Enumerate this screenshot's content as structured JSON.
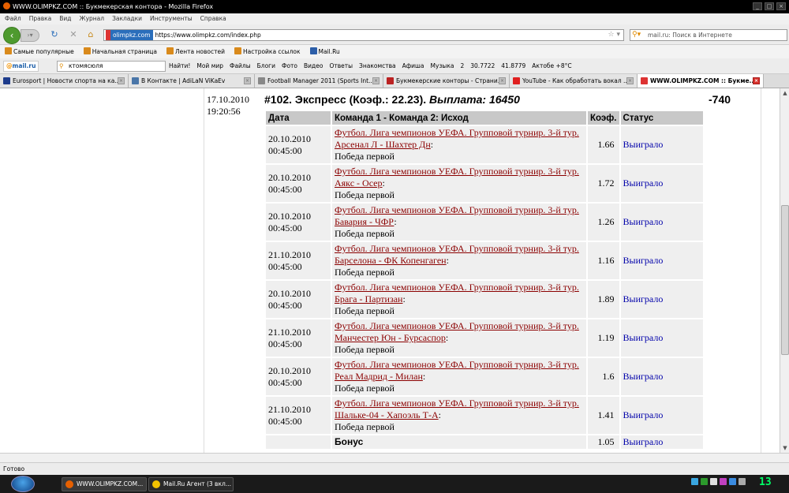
{
  "window": {
    "title": "WWW.OLIMPKZ.COM :: Букмекерская контора - Mozilla Firefox"
  },
  "menu": [
    "Файл",
    "Правка",
    "Вид",
    "Журнал",
    "Закладки",
    "Инструменты",
    "Справка"
  ],
  "nav": {
    "site_label": "olimpkz.com",
    "url": "https://www.olimpkz.com/index.php",
    "search_placeholder": "mail.ru: Поиск в Интернете"
  },
  "bookmarks": [
    "Самые популярные",
    "Начальная страница",
    "Лента новостей",
    "Настройка ссылок",
    "Mail.Ru"
  ],
  "mailru": {
    "logo": "mail.ru",
    "search_value": "ктомясюля",
    "find_label": "Найти!",
    "items": [
      "Мой мир",
      "Файлы",
      "Блоги",
      "Фото",
      "Видео",
      "Ответы",
      "Знакомства",
      "Афиша",
      "Музыка",
      "2",
      "30.7722",
      "41.8779",
      "Актобе +8°C"
    ]
  },
  "tabs": [
    "Eurosport | Новости спорта на ка...",
    "В Контакте | AdiLaN ViKaEv",
    "Football Manager 2011 (Sports Int...",
    "Букмекерские конторы - Страни...",
    "YouTube - Как обработать вокал ...",
    "WWW.OLIMPKZ.COM :: Букме..."
  ],
  "bet": {
    "date": "17.10.2010",
    "time": "19:20:56",
    "title": "#102. Экспресс (Коэф.: 22.23).",
    "payout": "Выплата: 16450",
    "result": "-740",
    "headers": {
      "date": "Дата",
      "match": "Команда 1 - Команда 2: Исход",
      "coef": "Коэф.",
      "status": "Статус"
    },
    "rows": [
      {
        "date": "20.10.2010",
        "time": "00:45:00",
        "event": "Футбол. Лига чемпионов УЕФА. Групповой турнир. 3-й тур. Арсенал Л - Шахтер Дн",
        "outcome": "Победа первой",
        "coef": "1.66",
        "status": "Выиграло"
      },
      {
        "date": "20.10.2010",
        "time": "00:45:00",
        "event": "Футбол. Лига чемпионов УЕФА. Групповой турнир. 3-й тур. Аякс - Осер",
        "outcome": "Победа первой",
        "coef": "1.72",
        "status": "Выиграло"
      },
      {
        "date": "20.10.2010",
        "time": "00:45:00",
        "event": "Футбол. Лига чемпионов УЕФА. Групповой турнир. 3-й тур. Бавария - ЧФР",
        "outcome": "Победа первой",
        "coef": "1.26",
        "status": "Выиграло"
      },
      {
        "date": "21.10.2010",
        "time": "00:45:00",
        "event": "Футбол. Лига чемпионов УЕФА. Групповой турнир. 3-й тур. Барселона - ФК Копенгаген",
        "outcome": "Победа первой",
        "coef": "1.16",
        "status": "Выиграло"
      },
      {
        "date": "20.10.2010",
        "time": "00:45:00",
        "event": "Футбол. Лига чемпионов УЕФА. Групповой турнир. 3-й тур. Брага - Партизан",
        "outcome": "Победа первой",
        "coef": "1.89",
        "status": "Выиграло"
      },
      {
        "date": "21.10.2010",
        "time": "00:45:00",
        "event": "Футбол. Лига чемпионов УЕФА. Групповой турнир. 3-й тур. Манчестер Юн - Бурсаспор",
        "outcome": "Победа первой",
        "coef": "1.19",
        "status": "Выиграло"
      },
      {
        "date": "20.10.2010",
        "time": "00:45:00",
        "event": "Футбол. Лига чемпионов УЕФА. Групповой турнир. 3-й тур. Реал Мадрид - Милан",
        "outcome": "Победа первой",
        "coef": "1.6",
        "status": "Выиграло"
      },
      {
        "date": "21.10.2010",
        "time": "00:45:00",
        "event": "Футбол. Лига чемпионов УЕФА. Групповой турнир. 3-й тур. Шальке-04 - Хапоэль Т-А",
        "outcome": "Победа первой",
        "coef": "1.41",
        "status": "Выиграло"
      }
    ],
    "bonus": {
      "label": "Бонус",
      "coef": "1.05",
      "status": "Выиграло"
    }
  },
  "status": "Готово",
  "taskbar": {
    "items": [
      "WWW.OLIMPKZ.COM...",
      "Mail.Ru Агент (3 вкл..."
    ],
    "clock": "13"
  }
}
